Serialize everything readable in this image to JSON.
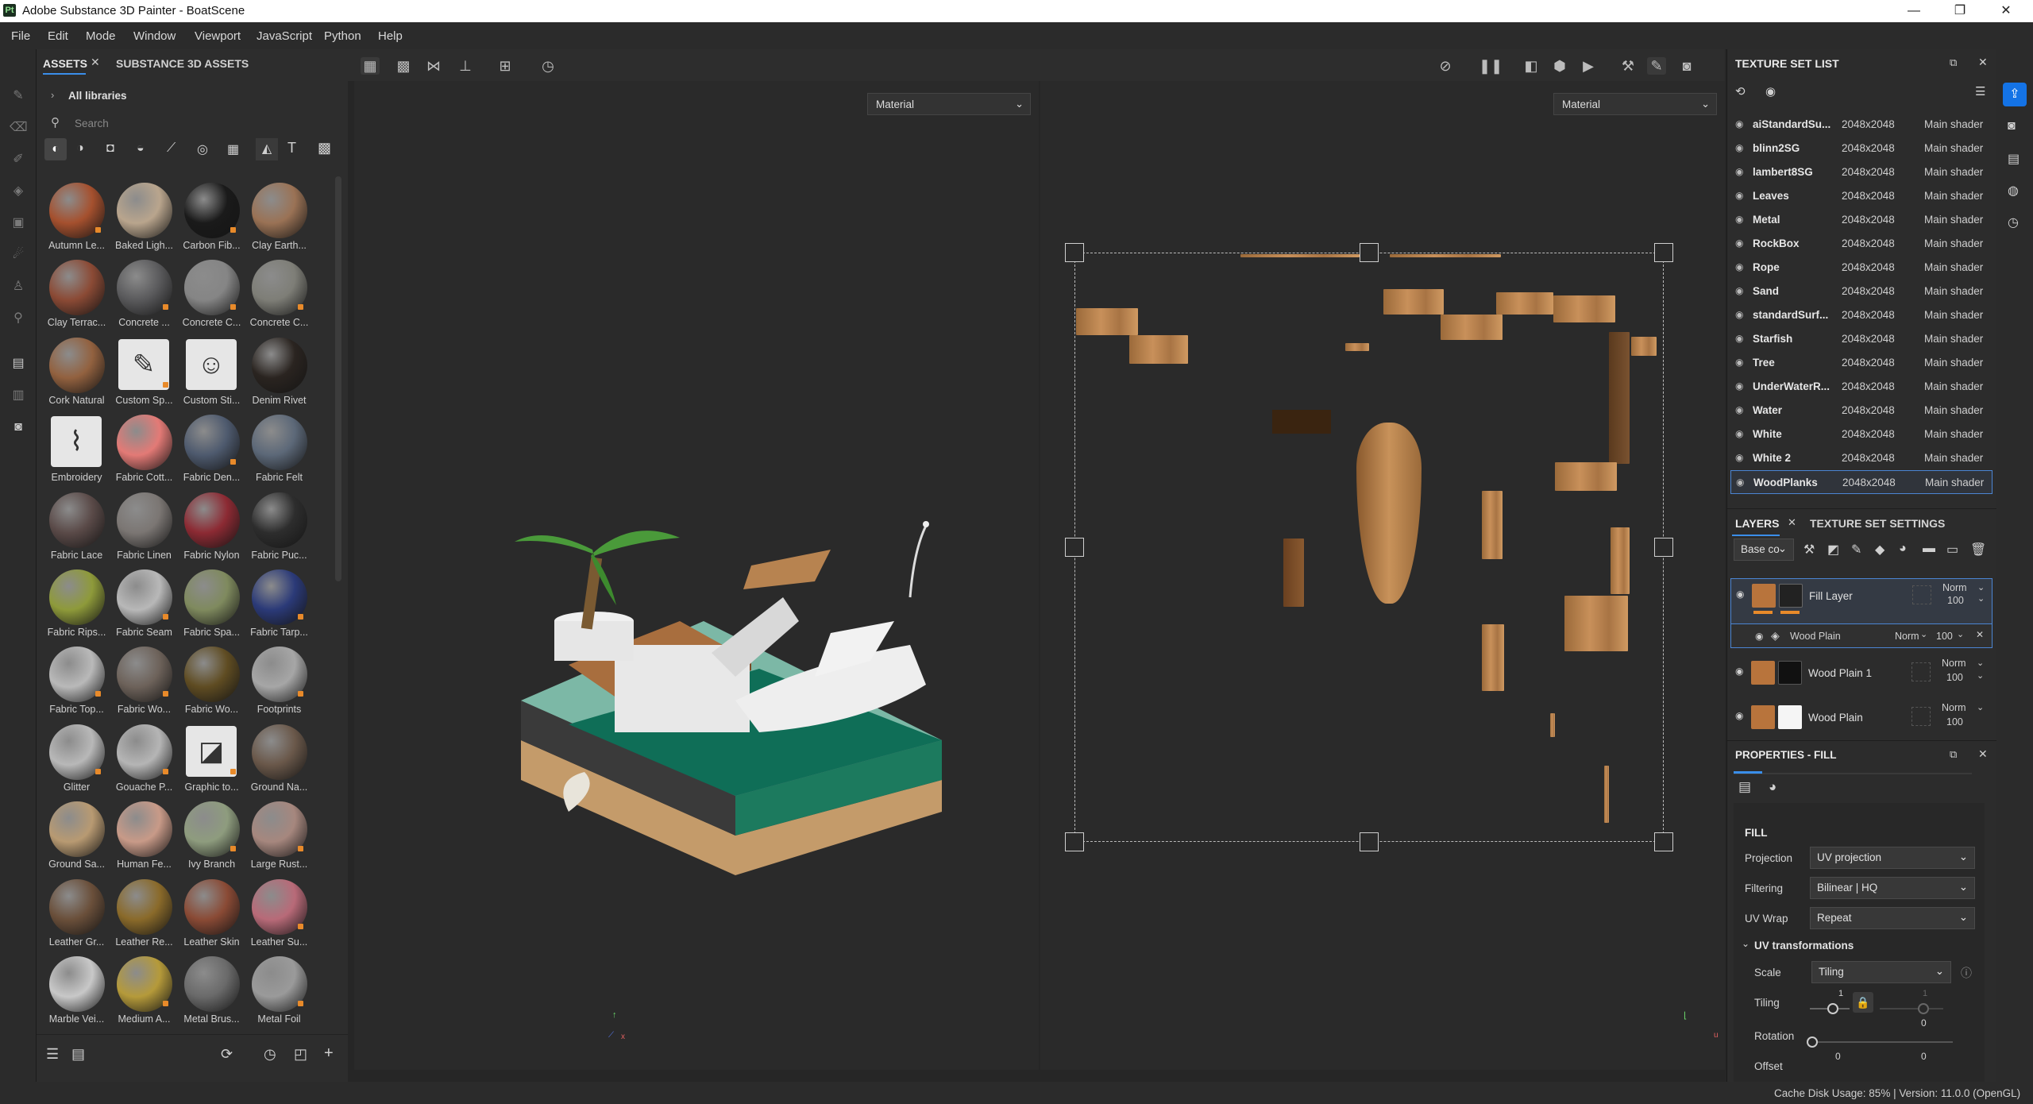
{
  "window": {
    "title": "Adobe Substance 3D Painter - BoatScene",
    "logo": "Pt"
  },
  "menu": [
    "File",
    "Edit",
    "Mode",
    "Window",
    "Viewport",
    "JavaScript",
    "Python",
    "Help"
  ],
  "assets": {
    "tab_assets": "ASSETS",
    "tab_substance": "SUBSTANCE 3D ASSETS",
    "breadcrumb": "All libraries",
    "search_placeholder": "Search",
    "items": [
      {
        "label": "Autumn Le...",
        "color": "#a5502e",
        "badge": true
      },
      {
        "label": "Baked Ligh...",
        "color": "#b9a58d",
        "badge": false
      },
      {
        "label": "Carbon Fib...",
        "color": "#1a1a1a",
        "badge": true
      },
      {
        "label": "Clay Earth...",
        "color": "#9a7255",
        "badge": false
      },
      {
        "label": "Clay Terrac...",
        "color": "#8b4a35",
        "badge": false
      },
      {
        "label": "Concrete ...",
        "color": "#5a5a5c",
        "badge": true
      },
      {
        "label": "Concrete C...",
        "color": "#858585",
        "badge": true
      },
      {
        "label": "Concrete C...",
        "color": "#7e7e77",
        "badge": true
      },
      {
        "label": "Cork Natural",
        "color": "#92613f",
        "badge": false
      },
      {
        "label": "Custom Sp...",
        "color": "icon",
        "badge": true,
        "icon": "✎"
      },
      {
        "label": "Custom Sti...",
        "color": "icon",
        "badge": false,
        "icon": "☺"
      },
      {
        "label": "Denim Rivet",
        "color": "#2a2420",
        "badge": false
      },
      {
        "label": "Embroidery",
        "color": "icon",
        "badge": false,
        "icon": "⌇"
      },
      {
        "label": "Fabric Cott...",
        "color": "#e37a76",
        "badge": false
      },
      {
        "label": "Fabric Den...",
        "color": "#4e5a6e",
        "badge": true
      },
      {
        "label": "Fabric Felt",
        "color": "#5c6878",
        "badge": false
      },
      {
        "label": "Fabric Lace",
        "color": "#5a4a48",
        "badge": false
      },
      {
        "label": "Fabric Linen",
        "color": "#7b7673",
        "badge": false
      },
      {
        "label": "Fabric Nylon",
        "color": "#8c2a33",
        "badge": false
      },
      {
        "label": "Fabric Puc...",
        "color": "#2d2d2d",
        "badge": false
      },
      {
        "label": "Fabric Rips...",
        "color": "#8e9a3a",
        "badge": false
      },
      {
        "label": "Fabric Seam",
        "color": "#b8b8b8",
        "badge": true
      },
      {
        "label": "Fabric Spa...",
        "color": "#7f8a5e",
        "badge": false
      },
      {
        "label": "Fabric Tarp...",
        "color": "#2b3a78",
        "badge": true
      },
      {
        "label": "Fabric Top...",
        "color": "#b9b9b9",
        "badge": true
      },
      {
        "label": "Fabric Wo...",
        "color": "#6d625a",
        "badge": true
      },
      {
        "label": "Fabric Wo...",
        "color": "#5f4c22",
        "badge": false
      },
      {
        "label": "Footprints",
        "color": "#a6a6a6",
        "badge": true
      },
      {
        "label": "Glitter",
        "color": "#b8b8b8",
        "badge": true
      },
      {
        "label": "Gouache P...",
        "color": "#b5b5b5",
        "badge": true
      },
      {
        "label": "Graphic to...",
        "color": "icon",
        "badge": true,
        "icon": "◪"
      },
      {
        "label": "Ground Na...",
        "color": "#6a584a",
        "badge": false
      },
      {
        "label": "Ground Sa...",
        "color": "#b89a72",
        "badge": false
      },
      {
        "label": "Human Fe...",
        "color": "#c89a88",
        "badge": false
      },
      {
        "label": "Ivy Branch",
        "color": "#8e9c7e",
        "badge": true
      },
      {
        "label": "Large Rust...",
        "color": "#a6877e",
        "badge": true
      },
      {
        "label": "Leather Gr...",
        "color": "#6a4f3a",
        "badge": false
      },
      {
        "label": "Leather Re...",
        "color": "#8a6a2a",
        "badge": false
      },
      {
        "label": "Leather Skin",
        "color": "#8a4a35",
        "badge": false
      },
      {
        "label": "Leather Su...",
        "color": "#b86a78",
        "badge": true
      },
      {
        "label": "Marble Vei...",
        "color": "#c8c8c8",
        "badge": false
      },
      {
        "label": "Medium A...",
        "color": "#b59a3a",
        "badge": true
      },
      {
        "label": "Metal Brus...",
        "color": "#6a6a6a",
        "badge": false
      },
      {
        "label": "Metal Foil",
        "color": "#9a9a9a",
        "badge": true
      }
    ]
  },
  "viewports": {
    "left_mode": "Material",
    "right_mode": "Material"
  },
  "texture_sets": {
    "title": "TEXTURE SET LIST",
    "rows": [
      {
        "name": "aiStandardSu...",
        "res": "2048x2048",
        "shader": "Main shader"
      },
      {
        "name": "blinn2SG",
        "res": "2048x2048",
        "shader": "Main shader"
      },
      {
        "name": "lambert8SG",
        "res": "2048x2048",
        "shader": "Main shader"
      },
      {
        "name": "Leaves",
        "res": "2048x2048",
        "shader": "Main shader"
      },
      {
        "name": "Metal",
        "res": "2048x2048",
        "shader": "Main shader"
      },
      {
        "name": "RockBox",
        "res": "2048x2048",
        "shader": "Main shader"
      },
      {
        "name": "Rope",
        "res": "2048x2048",
        "shader": "Main shader"
      },
      {
        "name": "Sand",
        "res": "2048x2048",
        "shader": "Main shader"
      },
      {
        "name": "standardSurf...",
        "res": "2048x2048",
        "shader": "Main shader"
      },
      {
        "name": "Starfish",
        "res": "2048x2048",
        "shader": "Main shader"
      },
      {
        "name": "Tree",
        "res": "2048x2048",
        "shader": "Main shader"
      },
      {
        "name": "UnderWaterR...",
        "res": "2048x2048",
        "shader": "Main shader"
      },
      {
        "name": "Water",
        "res": "2048x2048",
        "shader": "Main shader"
      },
      {
        "name": "White",
        "res": "2048x2048",
        "shader": "Main shader"
      },
      {
        "name": "White 2",
        "res": "2048x2048",
        "shader": "Main shader"
      },
      {
        "name": "WoodPlanks",
        "res": "2048x2048",
        "shader": "Main shader"
      }
    ]
  },
  "layers": {
    "tab_layers": "LAYERS",
    "tab_settings": "TEXTURE SET SETTINGS",
    "channel": "Base co",
    "items": [
      {
        "name": "Fill Layer",
        "blend": "Norm",
        "opacity": "100",
        "selected": true
      },
      {
        "name": "Wood Plain",
        "blend": "Norm",
        "opacity": "100",
        "sub": true
      },
      {
        "name": "Wood Plain 1",
        "blend": "Norm",
        "opacity": "100"
      },
      {
        "name": "Wood Plain",
        "blend": "Norm",
        "opacity": "100"
      }
    ]
  },
  "properties": {
    "title": "PROPERTIES - FILL",
    "section": "FILL",
    "projection_label": "Projection",
    "projection": "UV projection",
    "filtering_label": "Filtering",
    "filtering": "Bilinear | HQ",
    "uvwrap_label": "UV Wrap",
    "uvwrap": "Repeat",
    "uvtrans": "UV transformations",
    "scale_label": "Scale",
    "scale": "Tiling",
    "tiling_label": "Tiling",
    "tiling_u": "1",
    "tiling_v": "1",
    "tiling_min": "0",
    "rotation_label": "Rotation",
    "rotation_val": "0",
    "offset_label": "Offset",
    "offset_u": "0",
    "offset_v": "0"
  },
  "status": {
    "text": "Cache Disk Usage:    85% | Version: 11.0.0 (OpenGL)"
  }
}
